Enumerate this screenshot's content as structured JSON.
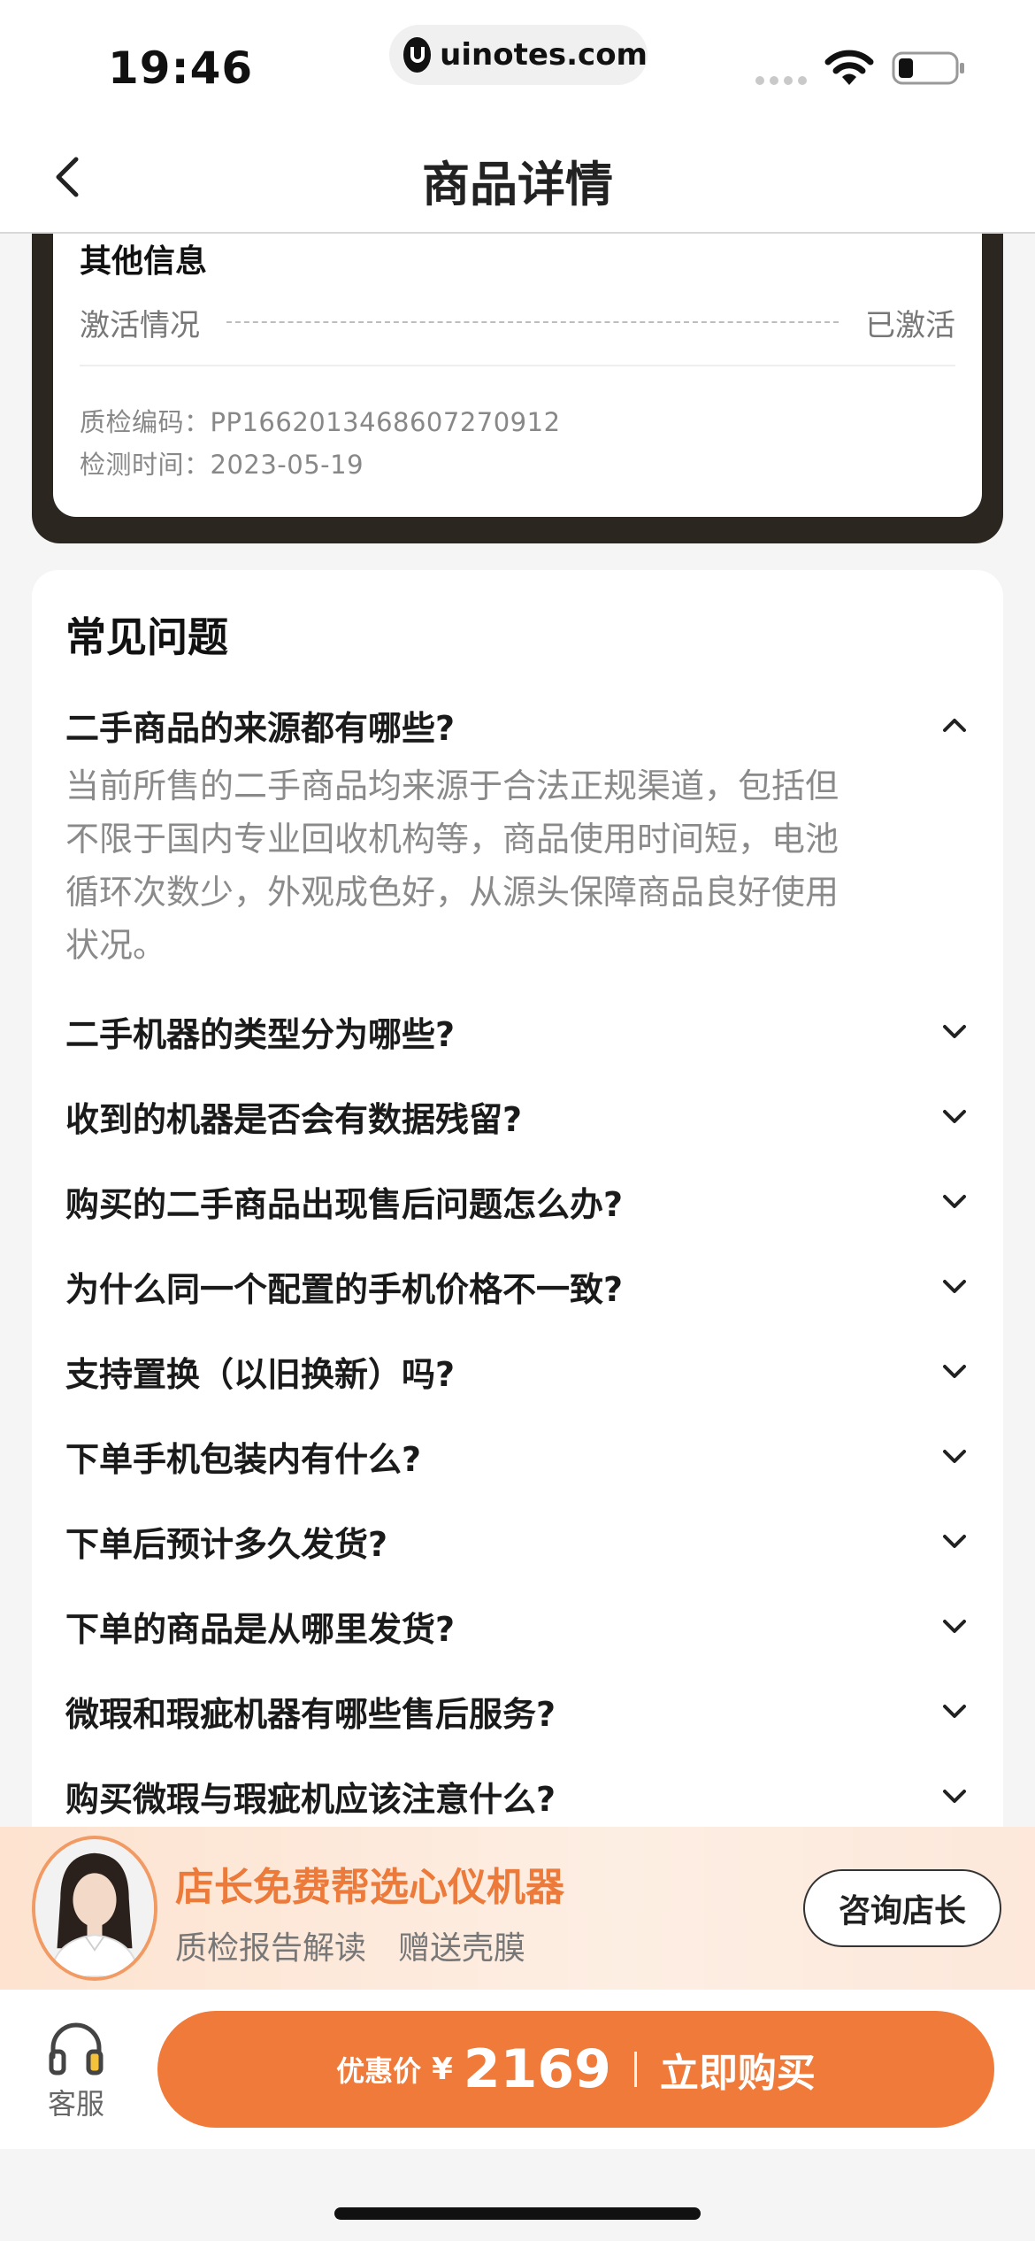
{
  "status_bar": {
    "time": "19:46",
    "url": "uinotes.com"
  },
  "nav": {
    "title": "商品详情"
  },
  "other_info": {
    "title": "其他信息",
    "activation_label": "激活情况",
    "activation_value": "已激活",
    "qc_code": "质检编码：PP1662013468607270912",
    "test_time": "检测时间：2023-05-19"
  },
  "faq": {
    "heading": "常见问题",
    "items": [
      {
        "q": "二手商品的来源都有哪些?",
        "expanded": true
      },
      {
        "q": "二手机器的类型分为哪些?"
      },
      {
        "q": "收到的机器是否会有数据残留?"
      },
      {
        "q": "购买的二手商品出现售后问题怎么办?"
      },
      {
        "q": "为什么同一个配置的手机价格不一致?"
      },
      {
        "q": "支持置换（以旧换新）吗?"
      },
      {
        "q": "下单手机包装内有什么?"
      },
      {
        "q": "下单后预计多久发货?"
      },
      {
        "q": "下单的商品是从哪里发货?"
      },
      {
        "q": "微瑕和瑕疵机器有哪些售后服务?"
      },
      {
        "q": "购买微瑕与瑕疵机应该注意什么?"
      }
    ],
    "answer_lines": [
      "当前所售的二手商品均来源于合法正规渠道，包括但",
      "不限于国内专业回收机构等，商品使用时间短，电池",
      "循环次数少，外观成色好，从源头保障商品良好使用",
      "状况。"
    ]
  },
  "promo": {
    "title": "店长免费帮选心仪机器",
    "sub1": "质检报告解读",
    "sub2": "赠送壳膜",
    "consult_label": "咨询店长"
  },
  "bottom_bar": {
    "service_label": "客服",
    "price_label": "优惠价",
    "currency": "¥",
    "price": "2169",
    "buy_label": "立即购买"
  },
  "colors": {
    "accent": "#ef7a3a",
    "frame": "#2b2620"
  }
}
